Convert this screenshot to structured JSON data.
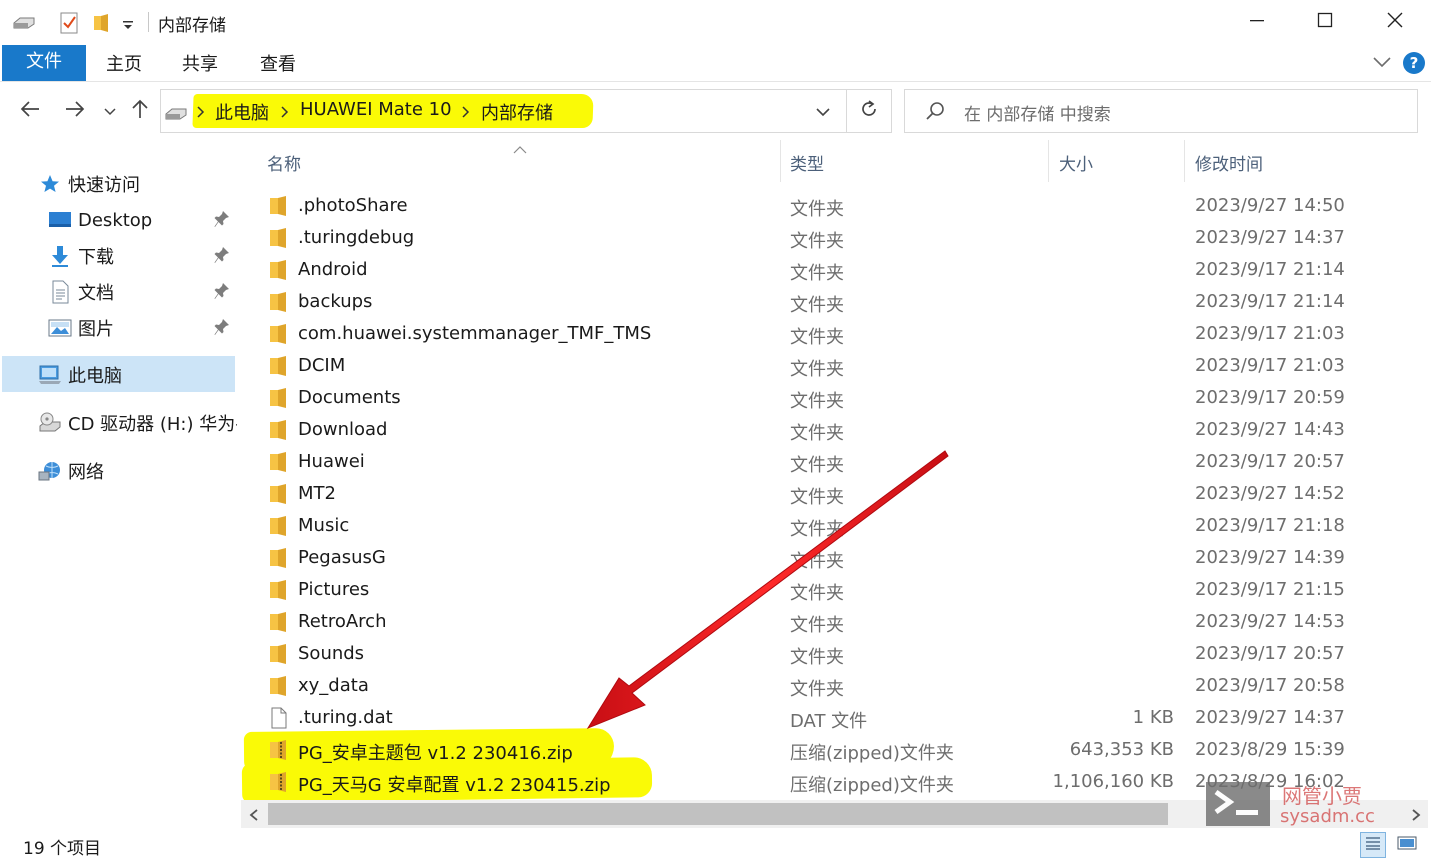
{
  "window": {
    "title": "内部存储",
    "minimize_icon": "minimize-icon",
    "maximize_icon": "maximize-icon",
    "close_icon": "close-icon"
  },
  "ribbon": {
    "tabs": [
      {
        "label": "文件",
        "active": true
      },
      {
        "label": "主页"
      },
      {
        "label": "共享"
      },
      {
        "label": "查看"
      }
    ],
    "help": "?"
  },
  "address_bar": {
    "breadcrumbs": [
      "此电脑",
      "HUAWEI Mate 10",
      "内部存储"
    ],
    "highlight_color": "#fafa06"
  },
  "search": {
    "placeholder": "在 内部存储 中搜索"
  },
  "sidebar": {
    "items": [
      {
        "label": "快速访问",
        "icon": "star-icon"
      },
      {
        "label": "Desktop",
        "icon": "desktop-icon",
        "pinned": true
      },
      {
        "label": "下载",
        "icon": "download-icon",
        "pinned": true
      },
      {
        "label": "文档",
        "icon": "document-icon",
        "pinned": true
      },
      {
        "label": "图片",
        "icon": "picture-icon",
        "pinned": true
      },
      {
        "label": "此电脑",
        "icon": "computer-icon",
        "selected": true
      },
      {
        "label": "CD 驱动器 (H:) 华为手",
        "icon": "cd-drive-icon"
      },
      {
        "label": "网络",
        "icon": "network-icon"
      }
    ]
  },
  "columns": {
    "name": "名称",
    "type": "类型",
    "size": "大小",
    "modified": "修改时间"
  },
  "files": [
    {
      "name": ".photoShare",
      "type": "文件夹",
      "size": "",
      "modified": "2023/9/27 14:50",
      "icon": "folder-icon"
    },
    {
      "name": ".turingdebug",
      "type": "文件夹",
      "size": "",
      "modified": "2023/9/27 14:37",
      "icon": "folder-icon"
    },
    {
      "name": "Android",
      "type": "文件夹",
      "size": "",
      "modified": "2023/9/17 21:14",
      "icon": "folder-icon"
    },
    {
      "name": "backups",
      "type": "文件夹",
      "size": "",
      "modified": "2023/9/17 21:14",
      "icon": "folder-icon"
    },
    {
      "name": "com.huawei.systemmanager_TMF_TMS",
      "type": "文件夹",
      "size": "",
      "modified": "2023/9/17 21:03",
      "icon": "folder-icon"
    },
    {
      "name": "DCIM",
      "type": "文件夹",
      "size": "",
      "modified": "2023/9/17 21:03",
      "icon": "folder-icon"
    },
    {
      "name": "Documents",
      "type": "文件夹",
      "size": "",
      "modified": "2023/9/17 20:59",
      "icon": "folder-icon"
    },
    {
      "name": "Download",
      "type": "文件夹",
      "size": "",
      "modified": "2023/9/27 14:43",
      "icon": "folder-icon"
    },
    {
      "name": "Huawei",
      "type": "文件夹",
      "size": "",
      "modified": "2023/9/17 20:57",
      "icon": "folder-icon"
    },
    {
      "name": "MT2",
      "type": "文件夹",
      "size": "",
      "modified": "2023/9/27 14:52",
      "icon": "folder-icon"
    },
    {
      "name": "Music",
      "type": "文件夹",
      "size": "",
      "modified": "2023/9/17 21:18",
      "icon": "folder-icon"
    },
    {
      "name": "PegasusG",
      "type": "文件夹",
      "size": "",
      "modified": "2023/9/27 14:39",
      "icon": "folder-icon"
    },
    {
      "name": "Pictures",
      "type": "文件夹",
      "size": "",
      "modified": "2023/9/17 21:15",
      "icon": "folder-icon"
    },
    {
      "name": "RetroArch",
      "type": "文件夹",
      "size": "",
      "modified": "2023/9/27 14:53",
      "icon": "folder-icon"
    },
    {
      "name": "Sounds",
      "type": "文件夹",
      "size": "",
      "modified": "2023/9/17 20:57",
      "icon": "folder-icon"
    },
    {
      "name": "xy_data",
      "type": "文件夹",
      "size": "",
      "modified": "2023/9/17 20:58",
      "icon": "folder-icon"
    },
    {
      "name": ".turing.dat",
      "type": "DAT 文件",
      "size": "1 KB",
      "modified": "2023/9/27 14:37",
      "icon": "file-icon"
    },
    {
      "name": "PG_安卓主题包 v1.2 230416.zip",
      "type": "压缩(zipped)文件夹",
      "size": "643,353 KB",
      "modified": "2023/8/29 15:39",
      "icon": "zip-folder-icon"
    },
    {
      "name": "PG_天马G 安卓配置 v1.2 230415.zip",
      "type": "压缩(zipped)文件夹",
      "size": "1,106,160 KB",
      "modified": "2023/8/29 16:02",
      "icon": "zip-folder-icon"
    }
  ],
  "status_bar": {
    "item_count": "19 个项目"
  },
  "annotation": {
    "arrow_color": "#e8141b",
    "highlight_color": "#fafa06"
  },
  "watermark": {
    "cn": "网管小贾",
    "en": "sysadm.cc"
  }
}
